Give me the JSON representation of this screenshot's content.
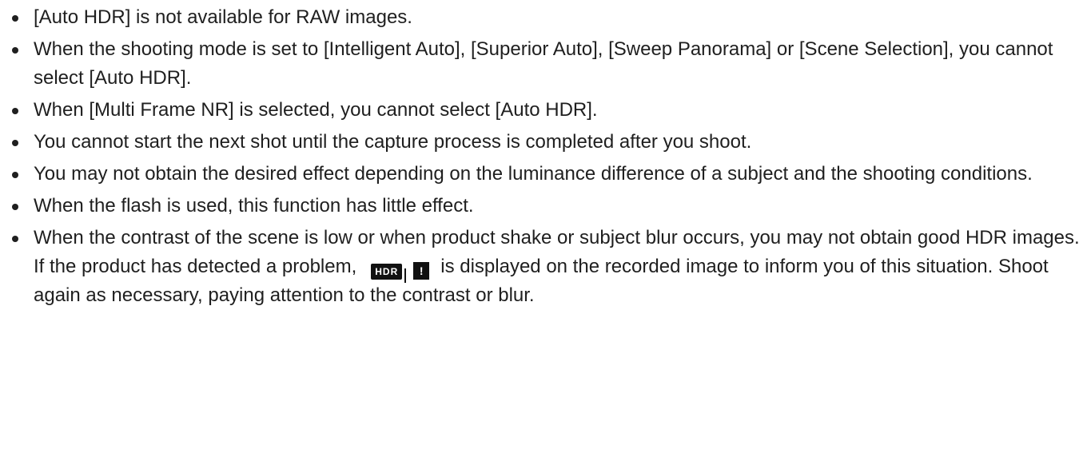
{
  "notes": [
    "[Auto HDR] is not available for RAW images.",
    "When the shooting mode is set to [Intelligent Auto], [Superior Auto], [Sweep Panorama] or [Scene Selection], you cannot select [Auto HDR].",
    "When [Multi Frame NR] is selected, you cannot select [Auto HDR].",
    "You cannot start the next shot until the capture process is completed after you shoot.",
    "You may not obtain the desired effect depending on the luminance difference of a subject and the shooting conditions.",
    "When the flash is used, this function has little effect."
  ],
  "last_note": {
    "before_icon": "When the contrast of the scene is low or when product shake or subject blur occurs, you may not obtain good HDR images. If the product has detected a problem,",
    "icon_hdr_text": "HDR",
    "icon_warning_text": "!",
    "after_icon": "is displayed on the recorded image to inform you of this situation. Shoot again as necessary, paying attention to the contrast or blur."
  },
  "icons": {
    "hdr_warning": "hdr-warning-icon"
  }
}
